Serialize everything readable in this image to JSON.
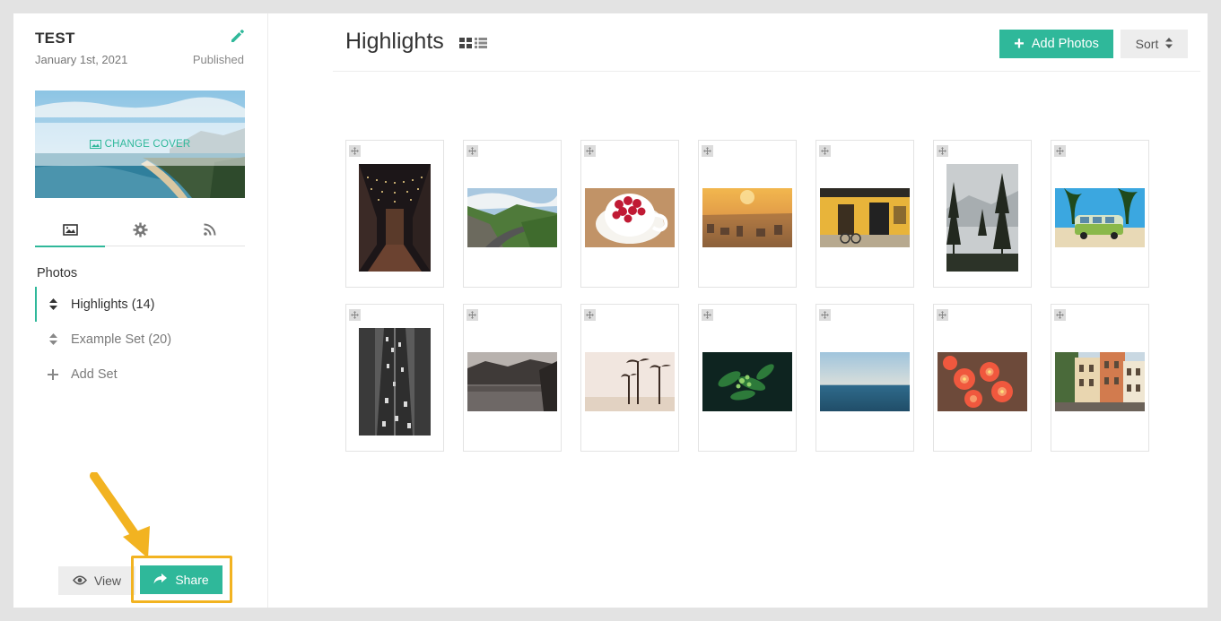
{
  "sidebar": {
    "album_title": "TEST",
    "album_date": "January 1st, 2021",
    "album_status": "Published",
    "change_cover_label": "CHANGE COVER",
    "tabs": [
      {
        "icon": "image-icon"
      },
      {
        "icon": "gear-icon"
      },
      {
        "icon": "rss-icon"
      }
    ],
    "section_label": "Photos",
    "sets": [
      {
        "label": "Highlights (14)",
        "icon": "sort-icon",
        "active": true
      },
      {
        "label": "Example Set (20)",
        "icon": "sort-icon",
        "active": false
      },
      {
        "label": "Add Set",
        "icon": "plus-icon",
        "active": false
      }
    ],
    "view_label": "View",
    "share_label": "Share"
  },
  "header": {
    "title": "Highlights",
    "add_photos_label": "Add Photos",
    "sort_label": "Sort"
  },
  "colors": {
    "accent": "#2fb89a",
    "highlight": "#f2b321"
  },
  "photos": [
    {
      "orientation": "portrait",
      "subject": "night market alley with string lights"
    },
    {
      "orientation": "landscape",
      "subject": "mountain road"
    },
    {
      "orientation": "landscape",
      "subject": "cup of raspberries"
    },
    {
      "orientation": "landscape",
      "subject": "city at sunset"
    },
    {
      "orientation": "landscape",
      "subject": "yellow storefront"
    },
    {
      "orientation": "portrait",
      "subject": "misty pine forest"
    },
    {
      "orientation": "landscape",
      "subject": "vintage van under palm trees"
    },
    {
      "orientation": "portrait",
      "subject": "aerial highway traffic"
    },
    {
      "orientation": "landscape",
      "subject": "forest lake"
    },
    {
      "orientation": "landscape",
      "subject": "palm trees on beach"
    },
    {
      "orientation": "landscape",
      "subject": "green plant close-up"
    },
    {
      "orientation": "landscape",
      "subject": "calm sea horizon"
    },
    {
      "orientation": "landscape",
      "subject": "orange flowers"
    },
    {
      "orientation": "landscape",
      "subject": "colorful old buildings"
    }
  ]
}
